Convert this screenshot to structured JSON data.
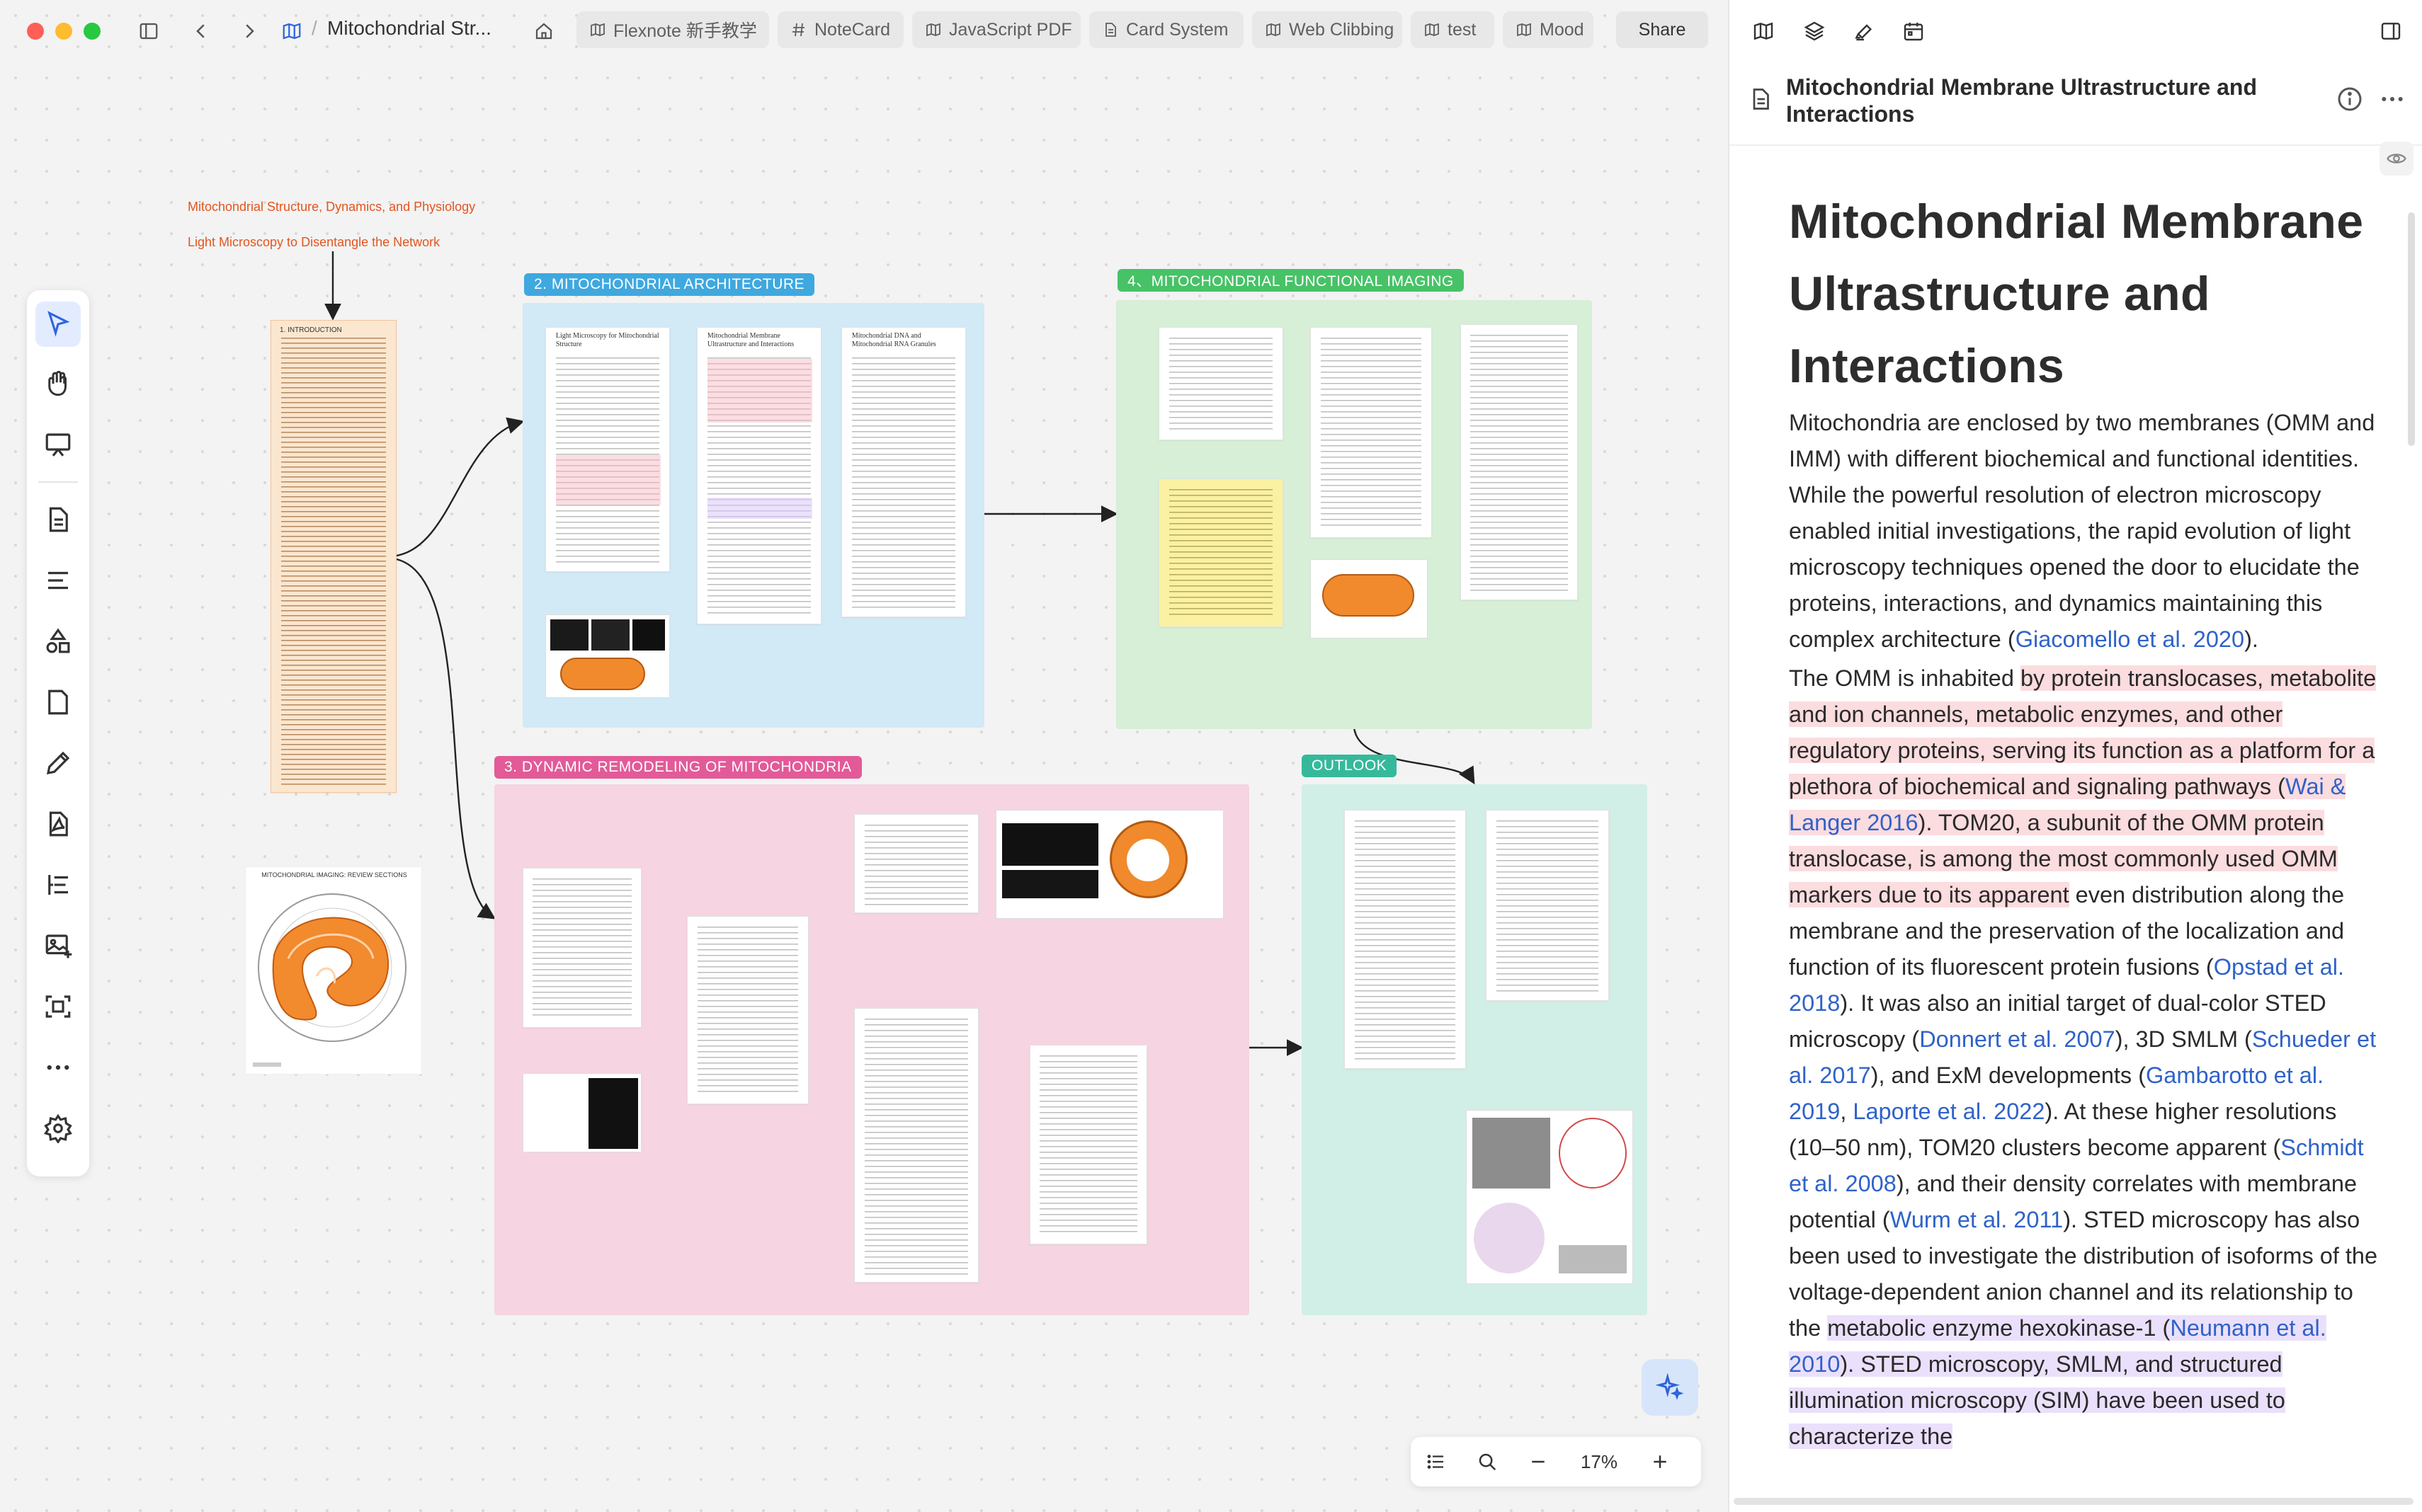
{
  "topbar": {
    "breadcrumb": "Mitochondrial Str...",
    "tabs": [
      {
        "label": "Flexnote 新手教学",
        "icon": "map-icon"
      },
      {
        "label": "NoteCard",
        "icon": "hash-icon"
      },
      {
        "label": "JavaScript PDF",
        "icon": "map-icon"
      },
      {
        "label": "Card System",
        "icon": "document-icon"
      },
      {
        "label": "Web Clibbing",
        "icon": "map-icon"
      },
      {
        "label": "test",
        "icon": "map-icon"
      },
      {
        "label": "Mood",
        "icon": "map-icon"
      }
    ],
    "share_label": "Share"
  },
  "canvas": {
    "orange_titles": [
      "Mitochondrial Structure, Dynamics, and Physiology",
      "Light Microscopy to Disentangle the Network"
    ],
    "intro_label": "1. INTRODUCTION",
    "frames": {
      "architecture": "2.  MITOCHONDRIAL ARCHITECTURE",
      "remodeling": "3.  DYNAMIC REMODELING OF MITOCHONDRIA",
      "functional": "4、MITOCHONDRIAL FUNCTIONAL IMAGING",
      "outlook": "OUTLOOK"
    },
    "architecture_pages": [
      "Light Microscopy for Mitochondrial Structure",
      "Mitochondrial Membrane Ultrastructure and Interactions",
      "Mitochondrial DNA and Mitochondrial RNA Granules"
    ],
    "imaging_review_title": "MITOCHONDRIAL IMAGING: REVIEW SECTIONS",
    "colors": {
      "architecture": "#3fa8df",
      "remodeling": "#e35a98",
      "functional": "#47c267",
      "outlook": "#36b99a",
      "intro": "#f5a256",
      "accent": "#2e66e0"
    }
  },
  "zoom": {
    "value": "17%"
  },
  "panel": {
    "header_title": "Mitochondrial Membrane Ultrastructure and Interactions",
    "h1": "Mitochondrial Membrane Ultrastructure and Interactions",
    "p1": {
      "text": "Mitochondria are enclosed by two membranes (OMM and IMM) with different biochemical and functional identities. While the powerful resolution of electron microscopy enabled initial investigations, the rapid evolution of light microscopy techniques opened the door to elucidate the proteins, interactions, and dynamics maintaining this complex architecture (",
      "cite": "Giacomello et al. 2020",
      "end": ")."
    },
    "p2": {
      "s1": "The OMM is inhabited ",
      "s2_hl": "by protein translocases, metabolite and ion channels, metabolic enzymes, and other regulatory proteins, serving its function as a platform for a plethora of biochemical and signaling pathways (",
      "c1": "Wai & Langer 2016",
      "s3_hl": "). TOM20, a subunit of the OMM protein translocase, is among the most commonly used OMM markers due to its apparent",
      "s4": " even distribution along the membrane and the preservation of the localization and function of its fluorescent protein fusions (",
      "c2": "Opstad et al. 2018",
      "s5": "). It was also an initial target of dual-color STED microscopy (",
      "c3": "Donnert et al. 2007",
      "s6": "), 3D SMLM (",
      "c4": "Schueder et al. 2017",
      "s7": "), and ExM developments (",
      "c5": "Gambarotto et al. 2019",
      "s8": ", ",
      "c6": "Laporte et al. 2022",
      "s9": "). At these higher resolutions (10–50 nm), TOM20 clusters become apparent (",
      "c7": "Schmidt et al. 2008",
      "s10": "), and their density correlates with membrane potential (",
      "c8": "Wurm et al. 2011",
      "s11": "). STED microscopy has also been used to investigate the distribution of isoforms of the voltage-dependent anion channel and its relationship to the ",
      "s12_hl": "metabolic enzyme hexokinase-1 (",
      "c9": "Neumann et al. 2010",
      "s13_hl": "). STED microscopy, SMLM, and structured illumination microscopy (SIM) have been used to characterize the"
    }
  }
}
